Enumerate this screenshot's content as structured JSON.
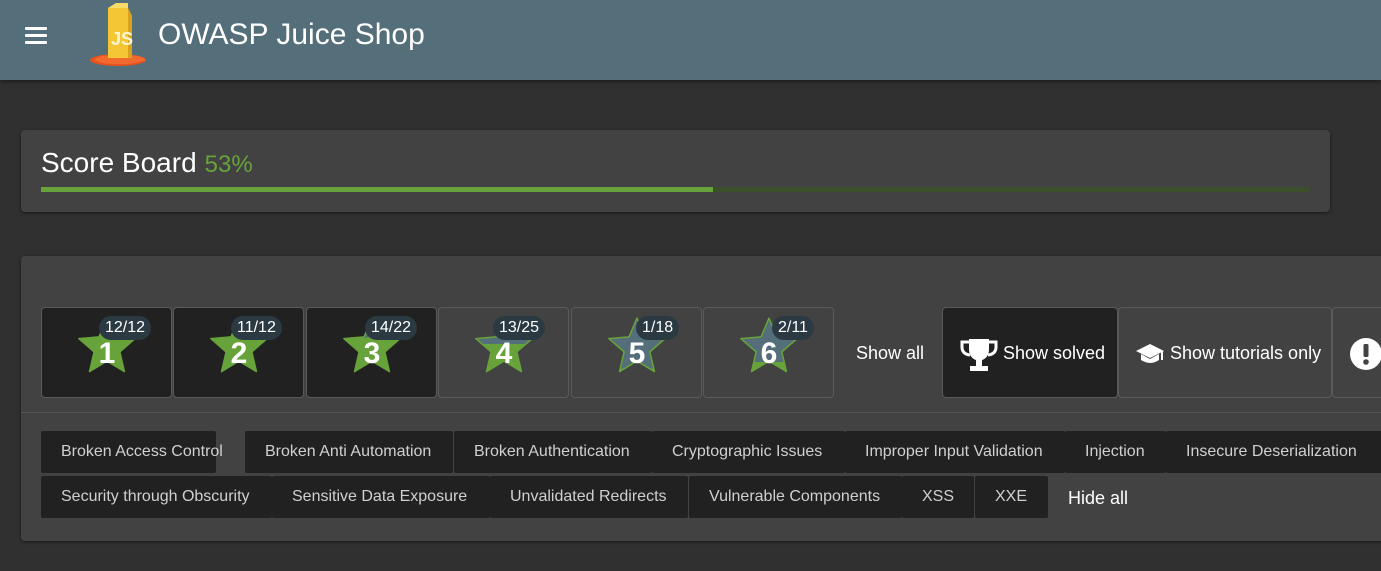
{
  "app": {
    "title": "OWASP Juice Shop",
    "icons": {
      "menu": "menu-icon",
      "logo": "juice-carton-logo"
    }
  },
  "score_board": {
    "title": "Score Board",
    "percent_text": "53%",
    "progress_percent": 53,
    "colors": {
      "accent": "#67a33a",
      "track": "#3b4f2a"
    }
  },
  "difficulties": [
    {
      "level": "1",
      "solved": "12/12",
      "fraction": 1.0,
      "active": true
    },
    {
      "level": "2",
      "solved": "11/12",
      "fraction": 0.917,
      "active": true
    },
    {
      "level": "3",
      "solved": "14/22",
      "fraction": 0.636,
      "active": true
    },
    {
      "level": "4",
      "solved": "13/25",
      "fraction": 0.52,
      "active": false
    },
    {
      "level": "5",
      "solved": "1/18",
      "fraction": 0.056,
      "active": false
    },
    {
      "level": "6",
      "solved": "2/11",
      "fraction": 0.182,
      "active": false
    }
  ],
  "difficulty_show_all": "Show all",
  "toggles": {
    "show_solved": {
      "label": "Show solved",
      "icon": "trophy-icon",
      "active": true
    },
    "show_tutorials": {
      "label": "Show tutorials only",
      "icon": "graduation-cap-icon",
      "active": false
    },
    "alert": {
      "icon": "exclamation-icon"
    }
  },
  "categories": [
    "Broken Access Control",
    "Broken Anti Automation",
    "Broken Authentication",
    "Cryptographic Issues",
    "Improper Input Validation",
    "Injection",
    "Insecure Deserialization",
    "Security through Obscurity",
    "Sensitive Data Exposure",
    "Unvalidated Redirects",
    "Vulnerable Components",
    "XSS",
    "XXE"
  ],
  "categories_hide_all": "Hide all",
  "colors": {
    "toolbar": "#546e7a",
    "background": "#303030",
    "card": "#424242",
    "star_solved": "#67a33a",
    "star_unsolved": "#546e7a"
  }
}
